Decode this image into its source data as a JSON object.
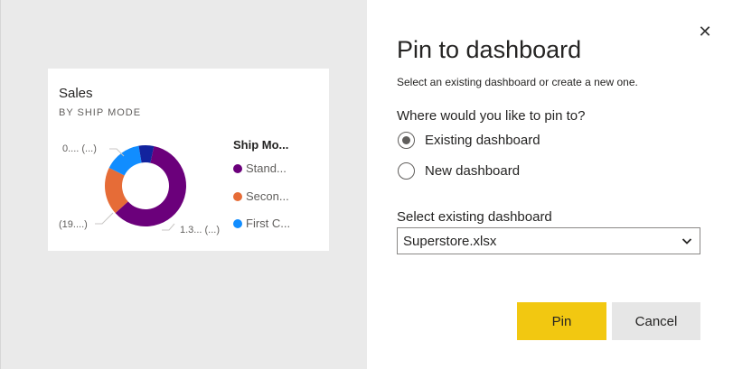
{
  "tile": {
    "title": "Sales",
    "subtitle": "BY SHIP MODE"
  },
  "chart_data": {
    "type": "pie",
    "title": "Sales",
    "subtitle": "BY SHIP MODE",
    "legend_title": "Ship Mo...",
    "legend_position": "right",
    "series": [
      {
        "name": "Stand...",
        "value": 0.6,
        "color": "#6b007b"
      },
      {
        "name": "Secon...",
        "value": 0.19,
        "color": "#e66c37"
      },
      {
        "name": "First C...",
        "value": 0.15,
        "color": "#118dff"
      },
      {
        "name": "",
        "value": 0.06,
        "color": "#12239e"
      }
    ],
    "data_labels": [
      "0.... (...)",
      "(19....)",
      "1.3... (...)"
    ]
  },
  "dialog": {
    "title": "Pin to dashboard",
    "description": "Select an existing dashboard or create a new one.",
    "question": "Where would you like to pin to?",
    "options": [
      {
        "label": "Existing dashboard",
        "checked": true
      },
      {
        "label": "New dashboard",
        "checked": false
      }
    ],
    "select_label": "Select existing dashboard",
    "select_value": "Superstore.xlsx",
    "pin_label": "Pin",
    "cancel_label": "Cancel",
    "close_glyph": "✕"
  }
}
